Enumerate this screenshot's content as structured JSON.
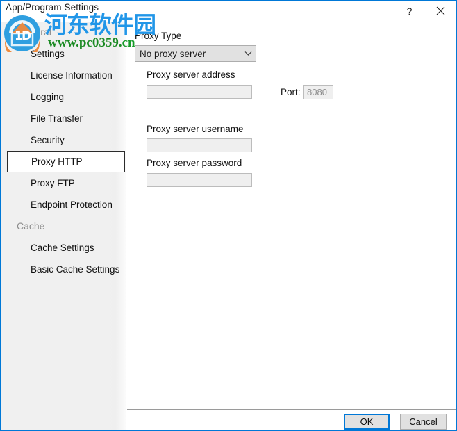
{
  "window": {
    "title": "App/Program Settings",
    "help_label": "?",
    "close_label": "✕"
  },
  "sidebar": {
    "groups": [
      {
        "label": "General",
        "items": [
          {
            "label": "Settings",
            "selected": false
          },
          {
            "label": "License Information",
            "selected": false
          },
          {
            "label": "Logging",
            "selected": false
          },
          {
            "label": "File Transfer",
            "selected": false
          },
          {
            "label": "Security",
            "selected": false
          },
          {
            "label": "Proxy HTTP",
            "selected": true
          },
          {
            "label": "Proxy FTP",
            "selected": false
          },
          {
            "label": "Endpoint Protection",
            "selected": false
          }
        ]
      },
      {
        "label": "Cache",
        "items": [
          {
            "label": "Cache Settings",
            "selected": false
          },
          {
            "label": "Basic Cache Settings",
            "selected": false
          }
        ]
      }
    ]
  },
  "content": {
    "proxy_type_label": "Proxy Type",
    "proxy_type_value": "No proxy server",
    "proxy_type_options": [
      "No proxy server"
    ],
    "chevron_icon": "chevron-down-icon",
    "address_label": "Proxy server address",
    "address_value": "",
    "port_label": "Port:",
    "port_value": "8080",
    "username_label": "Proxy server username",
    "username_value": "",
    "password_label": "Proxy server password",
    "password_value": ""
  },
  "footer": {
    "ok_label": "OK",
    "cancel_label": "Cancel"
  },
  "watermark": {
    "site_cn": "河东软件园",
    "site_url_main": "www.pc0359.",
    "site_url_tld": "cn"
  },
  "colors": {
    "accent": "#0078d7",
    "window_border": "#0078d7",
    "sidebar_bg": "#f0f0f0",
    "disabled_field_bg": "#efefef",
    "watermark_blue": "#2196e8",
    "watermark_green": "#1a8a22"
  }
}
